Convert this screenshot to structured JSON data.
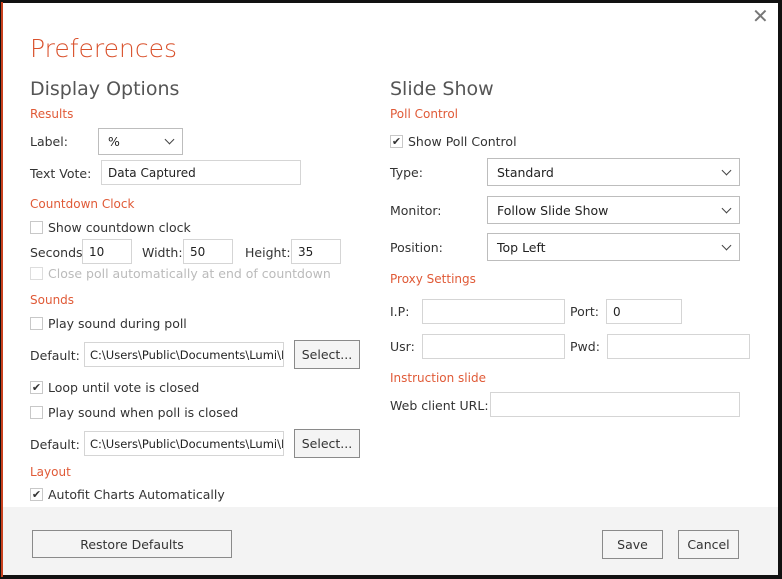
{
  "dialog": {
    "title": "Preferences",
    "close_icon": "close-icon"
  },
  "display": {
    "heading": "Display Options",
    "results": {
      "section": "Results",
      "label_label": "Label:",
      "label_value": "%",
      "text_vote_label": "Text Vote:",
      "text_vote_value": "Data Captured"
    },
    "countdown": {
      "section": "Countdown Clock",
      "show_label": "Show countdown clock",
      "show_checked": false,
      "seconds_label": "Seconds",
      "seconds_value": "10",
      "width_label": "Width:",
      "width_value": "50",
      "height_label": "Height:",
      "height_value": "35",
      "close_label": "Close poll automatically at end of countdown",
      "close_checked": false,
      "close_disabled": true
    },
    "sounds": {
      "section": "Sounds",
      "play_during_label": "Play sound during poll",
      "play_during_checked": false,
      "default1_label": "Default:",
      "default1_value": "C:\\Users\\Public\\Documents\\Lumi\\PP",
      "select1_label": "Select...",
      "loop_label": "Loop until vote is closed",
      "loop_checked": true,
      "play_closed_label": "Play sound when poll is closed",
      "play_closed_checked": false,
      "default2_label": "Default:",
      "default2_value": "C:\\Users\\Public\\Documents\\Lumi\\PP",
      "select2_label": "Select..."
    },
    "layout": {
      "section": "Layout",
      "autofit_label": "Autofit Charts Automatically",
      "autofit_checked": true
    }
  },
  "slideshow": {
    "heading": "Slide Show",
    "poll": {
      "section": "Poll Control",
      "show_label": "Show Poll Control",
      "show_checked": true,
      "type_label": "Type:",
      "type_value": "Standard",
      "monitor_label": "Monitor:",
      "monitor_value": "Follow Slide Show",
      "position_label": "Position:",
      "position_value": "Top Left"
    },
    "proxy": {
      "section": "Proxy Settings",
      "ip_label": "I.P:",
      "ip_value": "",
      "port_label": "Port:",
      "port_value": "0",
      "usr_label": "Usr:",
      "usr_value": "",
      "pwd_label": "Pwd:",
      "pwd_value": ""
    },
    "instruction": {
      "section": "Instruction slide",
      "url_label": "Web client URL:",
      "url_value": ""
    }
  },
  "footer": {
    "restore_label": "Restore Defaults",
    "save_label": "Save",
    "cancel_label": "Cancel"
  },
  "colors": {
    "accent": "#d9512c",
    "footer_bg": "#f3f3f3"
  }
}
